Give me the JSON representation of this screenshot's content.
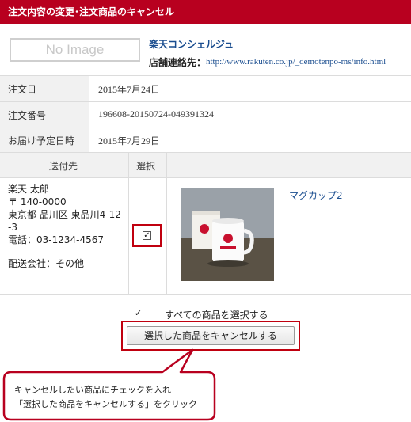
{
  "header": {
    "title": "注文内容の変更･注文商品のキャンセル"
  },
  "shop": {
    "no_image_text": "No Image",
    "name": "楽天コンシェルジュ",
    "contact_label": "店舗連絡先：",
    "contact_url": "http://www.rakuten.co.jp/_demotenpo-ms/info.html"
  },
  "order": {
    "date_label": "注文日",
    "date_value": "2015年7月24日",
    "number_label": "注文番号",
    "number_value": "196608-20150724-049391324",
    "delivery_label": "お届け予定日時",
    "delivery_value": "2015年7月29日"
  },
  "table": {
    "col_destination": "送付先",
    "col_select": "選択",
    "address_lines": [
      "楽天 太郎",
      "〒 140-0000",
      "東京都 品川区 東品川4-12",
      "-3",
      "電話：03-1234-4567"
    ],
    "shipping": "配送会社：その他",
    "item": {
      "name": "マグカップ2",
      "checked": true,
      "check_glyph": "✓"
    }
  },
  "select_all": {
    "label": "すべての商品を選択する",
    "checked": true,
    "check_glyph": "✓"
  },
  "cancel_button": {
    "label": "選択した商品をキャンセルする"
  },
  "callout": {
    "line1": "キャンセルしたい商品にチェックを入れ",
    "line2": "「選択した商品をキャンセルする」をクリック"
  },
  "colors": {
    "header_bg": "#b8001f",
    "accent_red": "#c0000f",
    "link_blue": "#1a4d8f"
  }
}
